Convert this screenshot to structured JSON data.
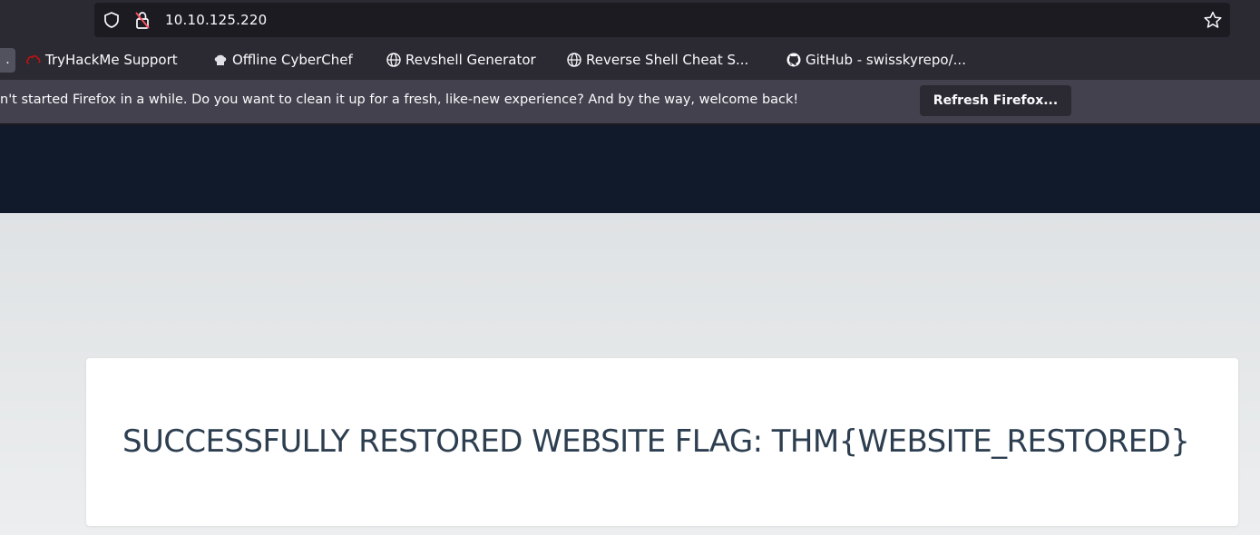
{
  "browser": {
    "url": "10.10.125.220",
    "bookmarks": {
      "overflow_stub": ".",
      "items": [
        {
          "label": "TryHackMe Support",
          "icon": "tryhackme-cloud-icon"
        },
        {
          "label": "Offline CyberChef",
          "icon": "chef-hat-icon"
        },
        {
          "label": "Revshell Generator",
          "icon": "globe-icon"
        },
        {
          "label": "Reverse Shell Cheat S...",
          "icon": "globe-icon"
        },
        {
          "label": "GitHub - swisskyrepo/...",
          "icon": "github-icon"
        }
      ]
    },
    "notification": {
      "text": "n't started Firefox in a while. Do you want to clean it up for a fresh, like-new experience? And by the way, welcome back!",
      "button_label": "Refresh Firefox..."
    }
  },
  "page": {
    "flag_text": "SUCCESSFULLY RESTORED WEBSITE FLAG: THM{WEBSITE_RESTORED}"
  },
  "colors": {
    "toolbar": "#2b2a33",
    "page_header": "#111a2b",
    "flag_text": "#2c3e50",
    "tryhackme_red": "#c11111"
  }
}
